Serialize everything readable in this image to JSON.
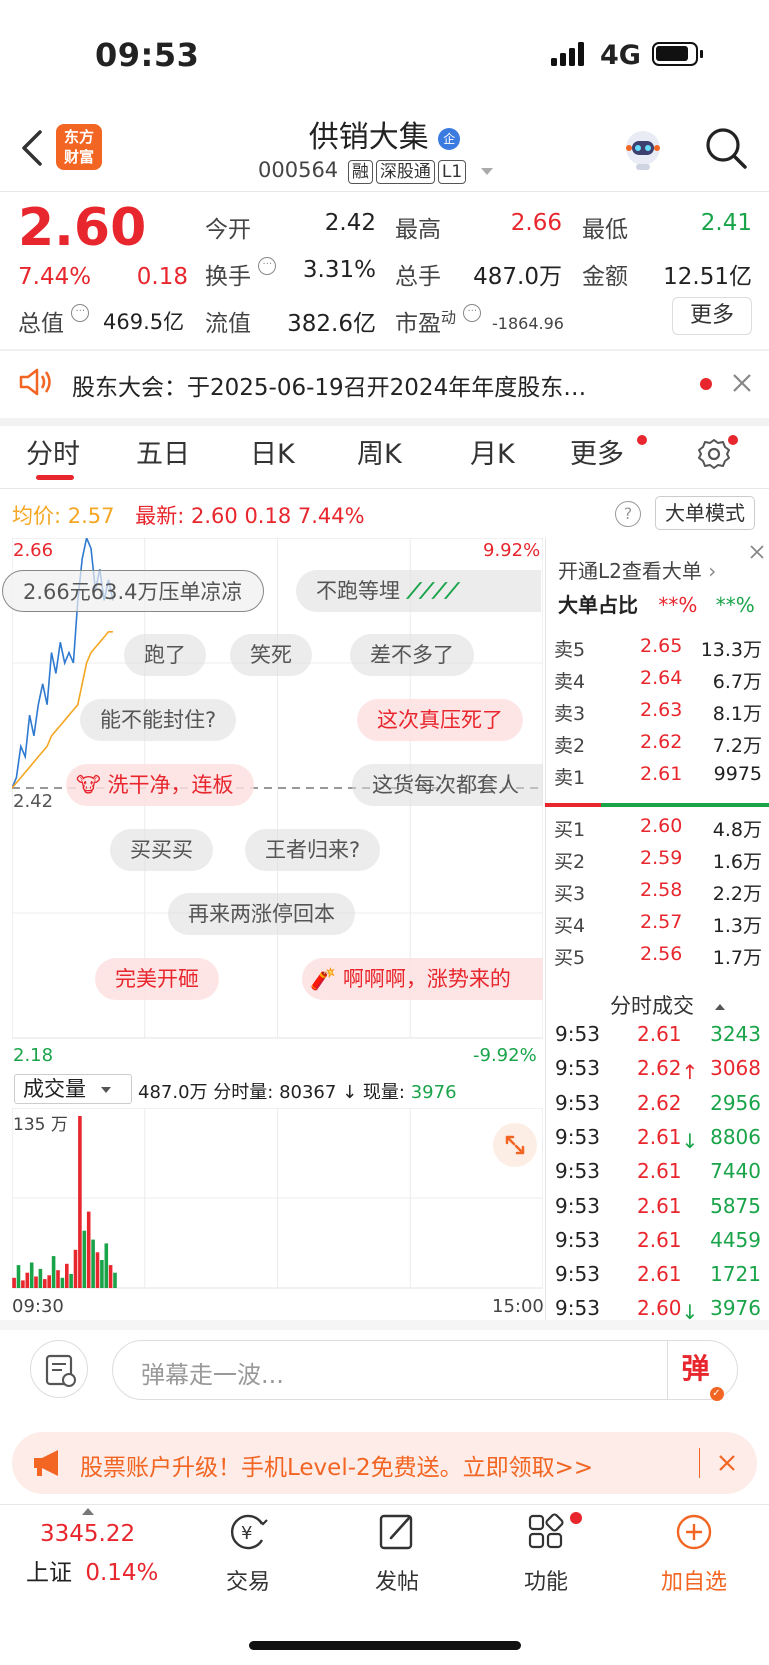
{
  "status_bar": {
    "time": "09:53",
    "network": "4G"
  },
  "header": {
    "stock_name": "供销大集",
    "stock_code": "000564",
    "tags": [
      "融",
      "深股通",
      "L1"
    ],
    "badge": "企",
    "logo_text_1": "东方",
    "logo_text_2": "财富"
  },
  "quote": {
    "price": "2.60",
    "change_pct": "7.44%",
    "change": "0.18",
    "open_label": "今开",
    "open": "2.42",
    "high_label": "最高",
    "high": "2.66",
    "low_label": "最低",
    "low": "2.41",
    "turnover_label": "换手",
    "turnover": "3.31%",
    "volume_label": "总手",
    "volume": "487.0万",
    "amount_label": "金额",
    "amount": "12.51亿",
    "mktcap_label": "总值",
    "mktcap": "469.5亿",
    "float_label": "流值",
    "float": "382.6亿",
    "pe_label": "市盈",
    "pe_sup": "动",
    "pe": "-1864.96",
    "more_label": "更多"
  },
  "notice": {
    "text": "股东大会：于2025-06-19召开2024年年度股东…"
  },
  "tabs": [
    "分时",
    "五日",
    "日K",
    "周K",
    "月K",
    "更多"
  ],
  "chart_info": {
    "avg_label": "均价:",
    "avg": "2.57",
    "latest_label": "最新:",
    "latest": "2.60",
    "latest_chg": "0.18",
    "latest_pct": "7.44%",
    "mode_label": "大单模式"
  },
  "chart_data": {
    "type": "line",
    "y_top_label": "2.66",
    "y_mid_label": "2.42",
    "y_bottom_label": "2.18",
    "pct_top_label": "9.92%",
    "pct_bottom_label": "-9.92%",
    "ylim": [
      2.18,
      2.66
    ],
    "prev_close": 2.42,
    "x_start_label": "09:30",
    "x_end_label": "15:00",
    "series": [
      {
        "name": "最新",
        "values": [
          2.42,
          2.43,
          2.46,
          2.45,
          2.49,
          2.47,
          2.5,
          2.52,
          2.5,
          2.55,
          2.53,
          2.56,
          2.54,
          2.55,
          2.54,
          2.6,
          2.64,
          2.66,
          2.65,
          2.61,
          2.63,
          2.6,
          2.62,
          2.6
        ]
      },
      {
        "name": "均价",
        "values": [
          2.42,
          2.425,
          2.43,
          2.435,
          2.44,
          2.445,
          2.45,
          2.455,
          2.46,
          2.47,
          2.475,
          2.48,
          2.485,
          2.49,
          2.495,
          2.5,
          2.52,
          2.54,
          2.55,
          2.555,
          2.56,
          2.565,
          2.57,
          2.57
        ]
      }
    ],
    "volume": {
      "label": "成交量",
      "total": "487.0万",
      "period_label": "分时量:",
      "period": "80367",
      "current_label": "现量:",
      "current": "3976",
      "max_label": "135 万",
      "ylim": [
        0,
        135
      ],
      "bars": [
        8,
        18,
        6,
        12,
        20,
        9,
        15,
        7,
        10,
        25,
        14,
        8,
        19,
        11,
        30,
        135,
        45,
        60,
        38,
        28,
        22,
        35,
        18,
        12
      ],
      "colors": [
        "r",
        "g",
        "r",
        "r",
        "g",
        "r",
        "g",
        "r",
        "r",
        "g",
        "r",
        "g",
        "r",
        "g",
        "r",
        "r",
        "g",
        "r",
        "g",
        "r",
        "g",
        "g",
        "r",
        "g"
      ]
    }
  },
  "danmaku": [
    "2.66元63.4万压单凉凉",
    "不跑等埋",
    "跑了",
    "笑死",
    "差不多了",
    "能不能封住?",
    "这次真压死了",
    "洗干净，连板",
    "这货每次都套人",
    "买买买",
    "王者归来?",
    "再来两涨停回本",
    "完美开砸",
    "啊啊啊，涨势来的"
  ],
  "order_book": {
    "promo": "开通L2查看大单",
    "ratio_label": "大单占比",
    "ratio_1": "**%",
    "ratio_2": "**%",
    "asks": [
      {
        "label": "卖5",
        "price": "2.65",
        "vol": "13.3万"
      },
      {
        "label": "卖4",
        "price": "2.64",
        "vol": "6.7万"
      },
      {
        "label": "卖3",
        "price": "2.63",
        "vol": "8.1万"
      },
      {
        "label": "卖2",
        "price": "2.62",
        "vol": "7.2万"
      },
      {
        "label": "卖1",
        "price": "2.61",
        "vol": "9975"
      }
    ],
    "bids": [
      {
        "label": "买1",
        "price": "2.60",
        "vol": "4.8万"
      },
      {
        "label": "买2",
        "price": "2.59",
        "vol": "1.6万"
      },
      {
        "label": "买3",
        "price": "2.58",
        "vol": "2.2万"
      },
      {
        "label": "买4",
        "price": "2.57",
        "vol": "1.3万"
      },
      {
        "label": "买5",
        "price": "2.56",
        "vol": "1.7万"
      }
    ]
  },
  "ticks": {
    "title": "分时成交",
    "rows": [
      {
        "time": "9:53",
        "price": "2.61",
        "vol": "3243",
        "arrow": ""
      },
      {
        "time": "9:53",
        "price": "2.62↑",
        "vol": "3068",
        "arrow": "up"
      },
      {
        "time": "9:53",
        "price": "2.62",
        "vol": "2956",
        "arrow": ""
      },
      {
        "time": "9:53",
        "price": "2.61↓",
        "vol": "8806",
        "arrow": "down"
      },
      {
        "time": "9:53",
        "price": "2.61",
        "vol": "7440",
        "arrow": ""
      },
      {
        "time": "9:53",
        "price": "2.61",
        "vol": "5875",
        "arrow": ""
      },
      {
        "time": "9:53",
        "price": "2.61",
        "vol": "4459",
        "arrow": ""
      },
      {
        "time": "9:53",
        "price": "2.61",
        "vol": "1721",
        "arrow": ""
      },
      {
        "time": "9:53",
        "price": "2.60↓",
        "vol": "3976",
        "arrow": "down"
      }
    ]
  },
  "comment_bar": {
    "placeholder": "弹幕走一波...",
    "danmaku_btn": "弹"
  },
  "promo_banner": {
    "text": "股票账户升级！手机Level-2免费送。立即领取>>"
  },
  "bottom_nav": {
    "index_value": "3345.22",
    "index_name": "上证",
    "index_pct": "0.14%",
    "trade": "交易",
    "post": "发帖",
    "features": "功能",
    "add_watch": "加自选"
  },
  "colors": {
    "up": "#e8262d",
    "down": "#1aa44a",
    "accent": "#f26522",
    "line": "#2f7ad1",
    "avg": "#f5a623"
  }
}
